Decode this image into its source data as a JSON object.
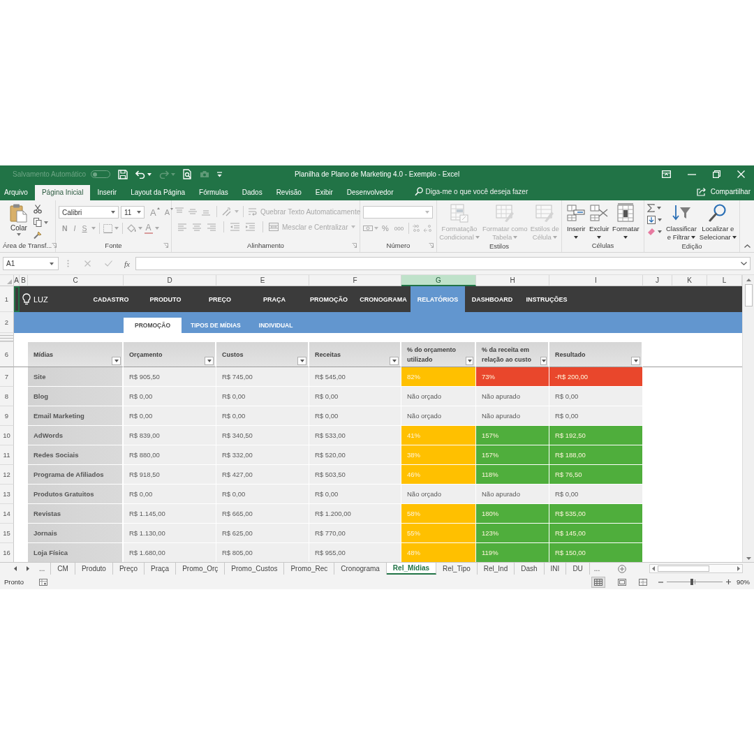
{
  "window": {
    "autosave_label": "Salvamento Automático",
    "autosave_on": false,
    "title": "Planilha de Plano de Marketing 4.0 - Exemplo - Excel"
  },
  "ribbon_tabs": [
    {
      "label": "Arquivo",
      "selected": false
    },
    {
      "label": "Página Inicial",
      "selected": true
    },
    {
      "label": "Inserir",
      "selected": false
    },
    {
      "label": "Layout da Página",
      "selected": false
    },
    {
      "label": "Fórmulas",
      "selected": false
    },
    {
      "label": "Dados",
      "selected": false
    },
    {
      "label": "Revisão",
      "selected": false
    },
    {
      "label": "Exibir",
      "selected": false
    },
    {
      "label": "Desenvolvedor",
      "selected": false
    }
  ],
  "tell_me": {
    "placeholder": "Diga-me o que você deseja fazer"
  },
  "share": {
    "label": "Compartilhar"
  },
  "ribbon": {
    "clipboard": {
      "label": "Área de Transf...",
      "paste": "Colar"
    },
    "font": {
      "label": "Fonte",
      "font_name": "Calibri",
      "font_size": "11",
      "grow": "A",
      "shrink": "A",
      "styles": [
        "N",
        "I",
        "S"
      ],
      "font_color": "A"
    },
    "alignment": {
      "label": "Alinhamento",
      "wrap_text": {
        "label": "Quebrar Texto Automaticamente",
        "disabled": true
      },
      "merge": {
        "label": "Mesclar e Centralizar",
        "disabled": true
      }
    },
    "number": {
      "label": "Número",
      "percent": "%",
      "thousands": "000"
    },
    "styles": {
      "label": "Estilos",
      "buttons": [
        {
          "kind": "conditional",
          "lines": [
            "Formatação",
            "Condicional"
          ],
          "disabled": true
        },
        {
          "kind": "table",
          "lines": [
            "Formatar como",
            "Tabela"
          ],
          "disabled": true
        },
        {
          "kind": "cellstyles",
          "lines": [
            "Estilos de",
            "Célula"
          ],
          "disabled": true
        }
      ]
    },
    "cells": {
      "label": "Células",
      "buttons": [
        {
          "kind": "insert",
          "lines": [
            "Inserir"
          ],
          "disabled": false
        },
        {
          "kind": "delete",
          "lines": [
            "Excluir"
          ],
          "disabled": false
        },
        {
          "kind": "format",
          "lines": [
            "Formatar"
          ],
          "disabled": false
        }
      ]
    },
    "editing": {
      "label": "Edição",
      "buttons": [
        {
          "kind": "sort",
          "lines": [
            "Classificar",
            "e Filtrar"
          ],
          "disabled": false
        },
        {
          "kind": "find",
          "lines": [
            "Localizar e",
            "Selecionar"
          ],
          "disabled": false
        }
      ]
    }
  },
  "formula_bar": {
    "name_box": "A1",
    "function_label": "fx"
  },
  "columns": [
    {
      "label": "A",
      "selected": false
    },
    {
      "label": "B",
      "selected": false
    },
    {
      "label": "C",
      "selected": false
    },
    {
      "label": "D",
      "selected": false
    },
    {
      "label": "E",
      "selected": false
    },
    {
      "label": "F",
      "selected": false
    },
    {
      "label": "G",
      "selected": true
    },
    {
      "label": "H",
      "selected": false
    },
    {
      "label": "I",
      "selected": false
    },
    {
      "label": "J",
      "selected": false
    },
    {
      "label": "K",
      "selected": false
    },
    {
      "label": "L",
      "selected": false
    }
  ],
  "nav": {
    "row_number": "1",
    "logo": "LUZ",
    "items": [
      {
        "label": "CADASTRO",
        "selected": false
      },
      {
        "label": "PRODUTO",
        "selected": false
      },
      {
        "label": "PREÇO",
        "selected": false
      },
      {
        "label": "PRAÇA",
        "selected": false
      },
      {
        "label": "PROMOÇÃO",
        "selected": false
      },
      {
        "label": "CRONOGRAMA",
        "selected": false
      },
      {
        "label": "RELATÓRIOS",
        "selected": true
      },
      {
        "label": "DASHBOARD",
        "selected": false
      },
      {
        "label": "INSTRUÇÕES",
        "selected": false
      }
    ]
  },
  "subnav": {
    "row_number": "2",
    "items": [
      {
        "label": "PROMOÇÃO",
        "selected": true
      },
      {
        "label": "TIPOS DE MÍDIAS",
        "selected": false
      },
      {
        "label": "INDIVIDUAL",
        "selected": false
      }
    ]
  },
  "table": {
    "header_row_number": "6",
    "columns": [
      "Mídias",
      "Orçamento",
      "Custos",
      "Receitas",
      "% do orçamento utilizado",
      "% da receita em relação ao custo",
      "Resultado"
    ],
    "rows": [
      {
        "row_number": "7",
        "cells": [
          {
            "text": "Site"
          },
          {
            "text": "R$ 905,50"
          },
          {
            "text": "R$ 745,00"
          },
          {
            "text": "R$ 545,00"
          },
          {
            "text": "82%",
            "color": "#ffc000"
          },
          {
            "text": "73%",
            "color": "#e9472c"
          },
          {
            "text": "-R$ 200,00",
            "color": "#e9472c"
          }
        ]
      },
      {
        "row_number": "8",
        "cells": [
          {
            "text": "Blog"
          },
          {
            "text": "R$ 0,00"
          },
          {
            "text": "R$ 0,00"
          },
          {
            "text": "R$ 0,00"
          },
          {
            "text": "Não orçado"
          },
          {
            "text": "Não apurado"
          },
          {
            "text": "R$ 0,00"
          }
        ]
      },
      {
        "row_number": "9",
        "cells": [
          {
            "text": "Email Marketing"
          },
          {
            "text": "R$ 0,00"
          },
          {
            "text": "R$ 0,00"
          },
          {
            "text": "R$ 0,00"
          },
          {
            "text": "Não orçado"
          },
          {
            "text": "Não apurado"
          },
          {
            "text": "R$ 0,00"
          }
        ]
      },
      {
        "row_number": "10",
        "cells": [
          {
            "text": "AdWords"
          },
          {
            "text": "R$ 839,00"
          },
          {
            "text": "R$ 340,50"
          },
          {
            "text": "R$ 533,00"
          },
          {
            "text": "41%",
            "color": "#ffc000"
          },
          {
            "text": "157%",
            "color": "#4fae3c"
          },
          {
            "text": "R$ 192,50",
            "color": "#4fae3c"
          }
        ]
      },
      {
        "row_number": "11",
        "cells": [
          {
            "text": "Redes Sociais"
          },
          {
            "text": "R$ 880,00"
          },
          {
            "text": "R$ 332,00"
          },
          {
            "text": "R$ 520,00"
          },
          {
            "text": "38%",
            "color": "#ffc000"
          },
          {
            "text": "157%",
            "color": "#4fae3c"
          },
          {
            "text": "R$ 188,00",
            "color": "#4fae3c"
          }
        ]
      },
      {
        "row_number": "12",
        "cells": [
          {
            "text": "Programa de Afiliados"
          },
          {
            "text": "R$ 918,50"
          },
          {
            "text": "R$ 427,00"
          },
          {
            "text": "R$ 503,50"
          },
          {
            "text": "46%",
            "color": "#ffc000"
          },
          {
            "text": "118%",
            "color": "#4fae3c"
          },
          {
            "text": "R$ 76,50",
            "color": "#4fae3c"
          }
        ]
      },
      {
        "row_number": "13",
        "cells": [
          {
            "text": "Produtos Gratuitos"
          },
          {
            "text": "R$ 0,00"
          },
          {
            "text": "R$ 0,00"
          },
          {
            "text": "R$ 0,00"
          },
          {
            "text": "Não orçado"
          },
          {
            "text": "Não apurado"
          },
          {
            "text": "R$ 0,00"
          }
        ]
      },
      {
        "row_number": "14",
        "cells": [
          {
            "text": "Revistas"
          },
          {
            "text": "R$ 1.145,00"
          },
          {
            "text": "R$ 665,00"
          },
          {
            "text": "R$ 1.200,00"
          },
          {
            "text": "58%",
            "color": "#ffc000"
          },
          {
            "text": "180%",
            "color": "#4fae3c"
          },
          {
            "text": "R$ 535,00",
            "color": "#4fae3c"
          }
        ]
      },
      {
        "row_number": "15",
        "cells": [
          {
            "text": "Jornais"
          },
          {
            "text": "R$ 1.130,00"
          },
          {
            "text": "R$ 625,00"
          },
          {
            "text": "R$ 770,00"
          },
          {
            "text": "55%",
            "color": "#ffc000"
          },
          {
            "text": "123%",
            "color": "#4fae3c"
          },
          {
            "text": "R$ 145,00",
            "color": "#4fae3c"
          }
        ]
      },
      {
        "row_number": "16",
        "cells": [
          {
            "text": "Loja Física"
          },
          {
            "text": "R$ 1.680,00"
          },
          {
            "text": "R$ 805,00"
          },
          {
            "text": "R$ 955,00"
          },
          {
            "text": "48%",
            "color": "#ffc000"
          },
          {
            "text": "119%",
            "color": "#4fae3c"
          },
          {
            "text": "R$ 150,00",
            "color": "#4fae3c"
          }
        ]
      }
    ]
  },
  "sheet_tabs": {
    "overflow_left": "...",
    "tabs": [
      {
        "label": "CM",
        "selected": false
      },
      {
        "label": "Produto",
        "selected": false
      },
      {
        "label": "Preço",
        "selected": false
      },
      {
        "label": "Praça",
        "selected": false
      },
      {
        "label": "Promo_Orç",
        "selected": false
      },
      {
        "label": "Promo_Custos",
        "selected": false
      },
      {
        "label": "Promo_Rec",
        "selected": false
      },
      {
        "label": "Cronograma",
        "selected": false
      },
      {
        "label": "Rel_Mídias",
        "selected": true
      },
      {
        "label": "Rel_Tipo",
        "selected": false
      },
      {
        "label": "Rel_Ind",
        "selected": false
      },
      {
        "label": "Dash",
        "selected": false
      },
      {
        "label": "INI",
        "selected": false
      },
      {
        "label": "DU",
        "selected": false
      }
    ],
    "overflow_right": "..."
  },
  "status_bar": {
    "text": "Pronto",
    "zoom_slider": {
      "level": 0.45
    },
    "zoom": "90%"
  }
}
